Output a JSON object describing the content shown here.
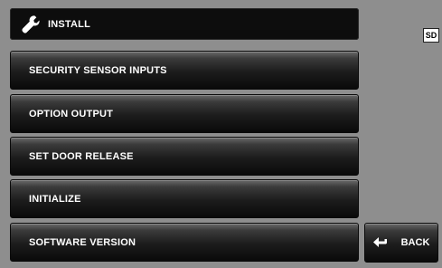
{
  "header": {
    "title": "INSTALL",
    "icon": "wrench-icon"
  },
  "status": {
    "sd_badge": "SD"
  },
  "menu": {
    "items": [
      {
        "label": "SECURITY SENSOR INPUTS"
      },
      {
        "label": "OPTION OUTPUT"
      },
      {
        "label": "SET DOOR RELEASE"
      },
      {
        "label": "INITIALIZE"
      },
      {
        "label": "SOFTWARE VERSION"
      }
    ]
  },
  "back": {
    "label": "BACK",
    "icon": "return-arrow-icon"
  },
  "colors": {
    "background": "#8e8e8e",
    "header": "#0d0d0d",
    "button_text": "#ffffff"
  }
}
